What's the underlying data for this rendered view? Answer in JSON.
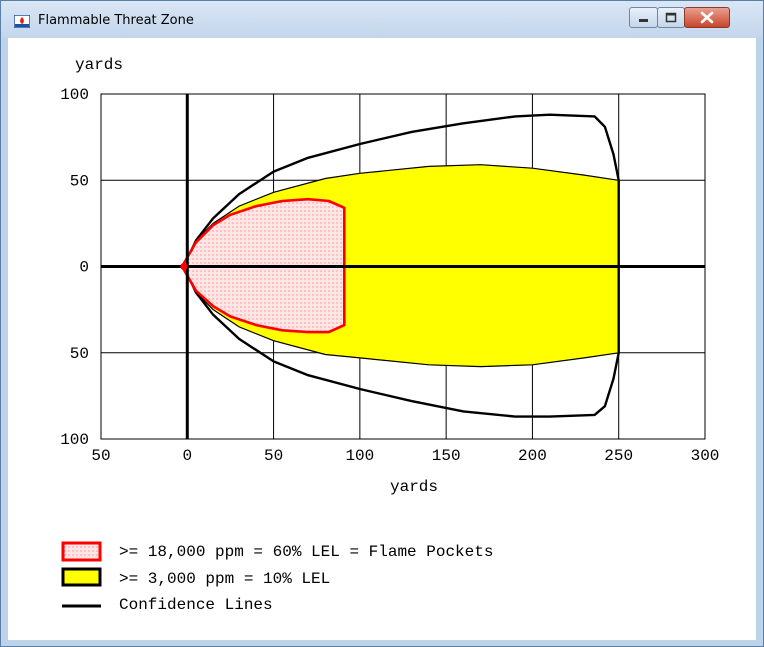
{
  "window": {
    "title": "Flammable Threat Zone",
    "controls": {
      "minimize": "minimize",
      "maximize": "maximize",
      "close": "close"
    }
  },
  "colors": {
    "flame_pocket_fill": "#ffe0e0",
    "flame_pocket_stroke": "#ff0000",
    "lel_fill": "#ffff00",
    "confidence": "#000000"
  },
  "chart_data": {
    "type": "area",
    "xlabel": "yards",
    "ylabel": "yards",
    "xlim": [
      -50,
      300
    ],
    "ylim": [
      -100,
      100
    ],
    "x_ticks": [
      -50,
      0,
      50,
      100,
      150,
      200,
      250,
      300
    ],
    "x_tick_labels": [
      "50",
      "0",
      "50",
      "100",
      "150",
      "200",
      "250",
      "300"
    ],
    "y_ticks": [
      100,
      50,
      0,
      -50,
      -100
    ],
    "y_tick_labels": [
      "100",
      "50",
      "0",
      "50",
      "100"
    ],
    "grid": true,
    "legend_position": "bottom-left",
    "series": [
      {
        "name": ">= 3,000 ppm = 10% LEL",
        "kind": "filled-zone",
        "points": [
          [
            -2,
            0
          ],
          [
            5,
            15
          ],
          [
            15,
            25
          ],
          [
            30,
            35
          ],
          [
            50,
            43
          ],
          [
            80,
            51
          ],
          [
            100,
            54
          ],
          [
            140,
            58
          ],
          [
            170,
            59
          ],
          [
            200,
            57
          ],
          [
            230,
            53
          ],
          [
            250,
            50
          ],
          [
            250,
            -50
          ],
          [
            230,
            -53
          ],
          [
            200,
            -57
          ],
          [
            170,
            -58
          ],
          [
            140,
            -57
          ],
          [
            100,
            -53
          ],
          [
            80,
            -51
          ],
          [
            50,
            -43
          ],
          [
            30,
            -35
          ],
          [
            15,
            -25
          ],
          [
            5,
            -15
          ],
          [
            -2,
            0
          ]
        ]
      },
      {
        "name": ">= 18,000 ppm = 60% LEL = Flame Pockets",
        "kind": "filled-zone",
        "points": [
          [
            -3,
            0
          ],
          [
            5,
            14
          ],
          [
            15,
            24
          ],
          [
            25,
            30
          ],
          [
            40,
            35
          ],
          [
            55,
            38
          ],
          [
            70,
            39
          ],
          [
            82,
            38
          ],
          [
            91,
            34
          ],
          [
            91,
            -34
          ],
          [
            82,
            -38
          ],
          [
            70,
            -38
          ],
          [
            55,
            -37
          ],
          [
            40,
            -34
          ],
          [
            25,
            -29
          ],
          [
            15,
            -23
          ],
          [
            5,
            -14
          ],
          [
            -3,
            0
          ]
        ]
      },
      {
        "name": "Confidence Lines",
        "kind": "line",
        "points": [
          [
            -2,
            0
          ],
          [
            5,
            15
          ],
          [
            15,
            28
          ],
          [
            30,
            42
          ],
          [
            50,
            55
          ],
          [
            70,
            63
          ],
          [
            100,
            71
          ],
          [
            130,
            78
          ],
          [
            160,
            83
          ],
          [
            190,
            87
          ],
          [
            210,
            88
          ],
          [
            236,
            87
          ],
          [
            242,
            81
          ],
          [
            247,
            65
          ],
          [
            250,
            50
          ],
          [
            250,
            -50
          ],
          [
            247,
            -65
          ],
          [
            242,
            -81
          ],
          [
            236,
            -86
          ],
          [
            210,
            -87
          ],
          [
            190,
            -87
          ],
          [
            160,
            -84
          ],
          [
            130,
            -78
          ],
          [
            100,
            -71
          ],
          [
            70,
            -63
          ],
          [
            50,
            -55
          ],
          [
            30,
            -42
          ],
          [
            15,
            -28
          ],
          [
            5,
            -15
          ],
          [
            -2,
            0
          ]
        ]
      }
    ]
  },
  "legend": [
    {
      "label": ">= 18,000 ppm = 60% LEL = Flame Pockets",
      "swatch": "flame"
    },
    {
      "label": ">= 3,000 ppm = 10% LEL",
      "swatch": "lel"
    },
    {
      "label": "Confidence Lines",
      "swatch": "line"
    }
  ]
}
